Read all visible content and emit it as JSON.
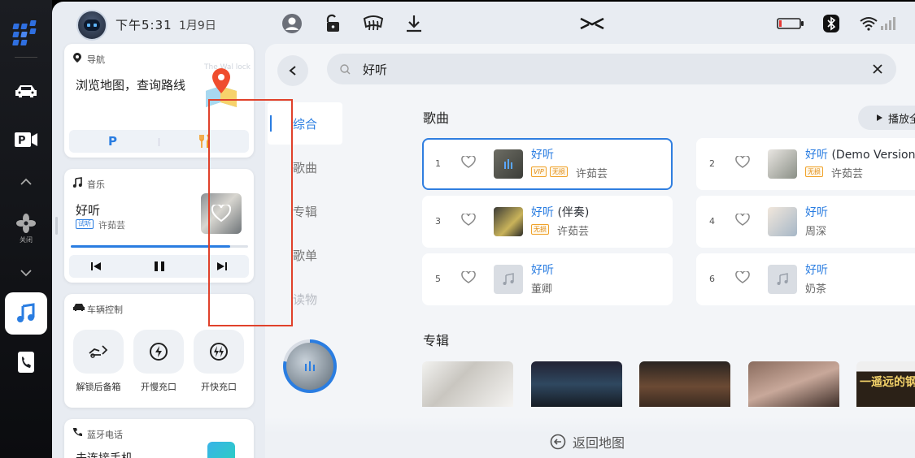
{
  "status_bar": {
    "time": "下午5:31",
    "date": "1月9日"
  },
  "rail": {
    "items": [
      {
        "name": "app-grid",
        "label": ""
      },
      {
        "name": "car",
        "label": ""
      },
      {
        "name": "parking",
        "label": ""
      },
      {
        "name": "fan",
        "label": "关闭"
      },
      {
        "name": "music",
        "label": ""
      },
      {
        "name": "phone",
        "label": ""
      }
    ]
  },
  "nav_card": {
    "title": "导航",
    "text": "浏览地图，查询路线",
    "map_watermark": "The Wal lock",
    "shortcut_parking": "P"
  },
  "music_card": {
    "title": "音乐",
    "song": "好听",
    "badge": "试听",
    "artist": "许茹芸",
    "progress": 0.9
  },
  "vehicle_card": {
    "title": "车辆控制",
    "controls": [
      {
        "label": "解锁后备箱"
      },
      {
        "label": "开慢充口"
      },
      {
        "label": "开快充口"
      }
    ]
  },
  "phone_card": {
    "title": "蓝牙电话",
    "text": "未连接手机"
  },
  "search": {
    "query": "好听"
  },
  "categories": [
    "综合",
    "歌曲",
    "专辑",
    "歌单",
    "读物"
  ],
  "songs_section": {
    "title": "歌曲",
    "play_all": "播放全部",
    "items": [
      {
        "num": "1",
        "title": "好听",
        "suffix": "",
        "artist": "许茹芸",
        "tags": [
          "VIP",
          "无损"
        ]
      },
      {
        "num": "2",
        "title": "好听",
        "suffix": " (Demo Version…",
        "artist": "许茹芸",
        "tags": [
          "无损"
        ]
      },
      {
        "num": "3",
        "title": "好听",
        "suffix": " (伴奏)",
        "artist": "许茹芸",
        "tags": [
          "无损"
        ]
      },
      {
        "num": "4",
        "title": "好听",
        "suffix": "",
        "artist": "周深",
        "tags": []
      },
      {
        "num": "5",
        "title": "好听",
        "suffix": "",
        "artist": "董卿",
        "tags": []
      },
      {
        "num": "6",
        "title": "好听",
        "suffix": "",
        "artist": "奶茶",
        "tags": []
      }
    ]
  },
  "albums_section": {
    "title": "专辑",
    "album5_text": "一遥远的钢琴"
  },
  "return_map": "返回地图",
  "colors": {
    "accent": "#2a7de1",
    "highlight_box": "#e0412b",
    "tag_orange": "#e08b14"
  }
}
